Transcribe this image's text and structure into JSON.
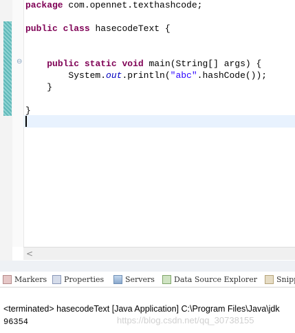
{
  "editor": {
    "lines": [
      {
        "segments": [
          {
            "t": "package",
            "c": "kw"
          },
          {
            "t": " com.opennet.texthashcode;",
            "c": ""
          }
        ]
      },
      {
        "segments": []
      },
      {
        "segments": [
          {
            "t": "public",
            "c": "kw"
          },
          {
            "t": " ",
            "c": ""
          },
          {
            "t": "class",
            "c": "kw"
          },
          {
            "t": " hasecodeText {",
            "c": ""
          }
        ]
      },
      {
        "segments": []
      },
      {
        "segments": []
      },
      {
        "segments": [
          {
            "t": "    ",
            "c": ""
          },
          {
            "t": "public",
            "c": "kw"
          },
          {
            "t": " ",
            "c": ""
          },
          {
            "t": "static",
            "c": "kw"
          },
          {
            "t": " ",
            "c": ""
          },
          {
            "t": "void",
            "c": "kw"
          },
          {
            "t": " main(String[] args) {",
            "c": ""
          }
        ]
      },
      {
        "segments": [
          {
            "t": "        System.",
            "c": ""
          },
          {
            "t": "out",
            "c": "field"
          },
          {
            "t": ".println(",
            "c": ""
          },
          {
            "t": "\"abc\"",
            "c": "str"
          },
          {
            "t": ".hashCode());",
            "c": ""
          }
        ]
      },
      {
        "segments": [
          {
            "t": "    }",
            "c": ""
          }
        ]
      },
      {
        "segments": []
      },
      {
        "segments": [
          {
            "t": "}",
            "c": ""
          }
        ]
      }
    ]
  },
  "tabs": [
    {
      "label": "Markers",
      "icon": "markers-icon"
    },
    {
      "label": "Properties",
      "icon": "properties-icon"
    },
    {
      "label": "Servers",
      "icon": "servers-icon"
    },
    {
      "label": "Data Source Explorer",
      "icon": "data-source-explorer-icon"
    },
    {
      "label": "Snipp",
      "icon": "snippets-icon"
    }
  ],
  "console": {
    "header": "<terminated> hasecodeText [Java Application] C:\\Program Files\\Java\\jdk",
    "output": "96354",
    "watermark": "https://blog.csdn.net/qq_30738155"
  },
  "scroll": {
    "left_arrow": "<"
  }
}
